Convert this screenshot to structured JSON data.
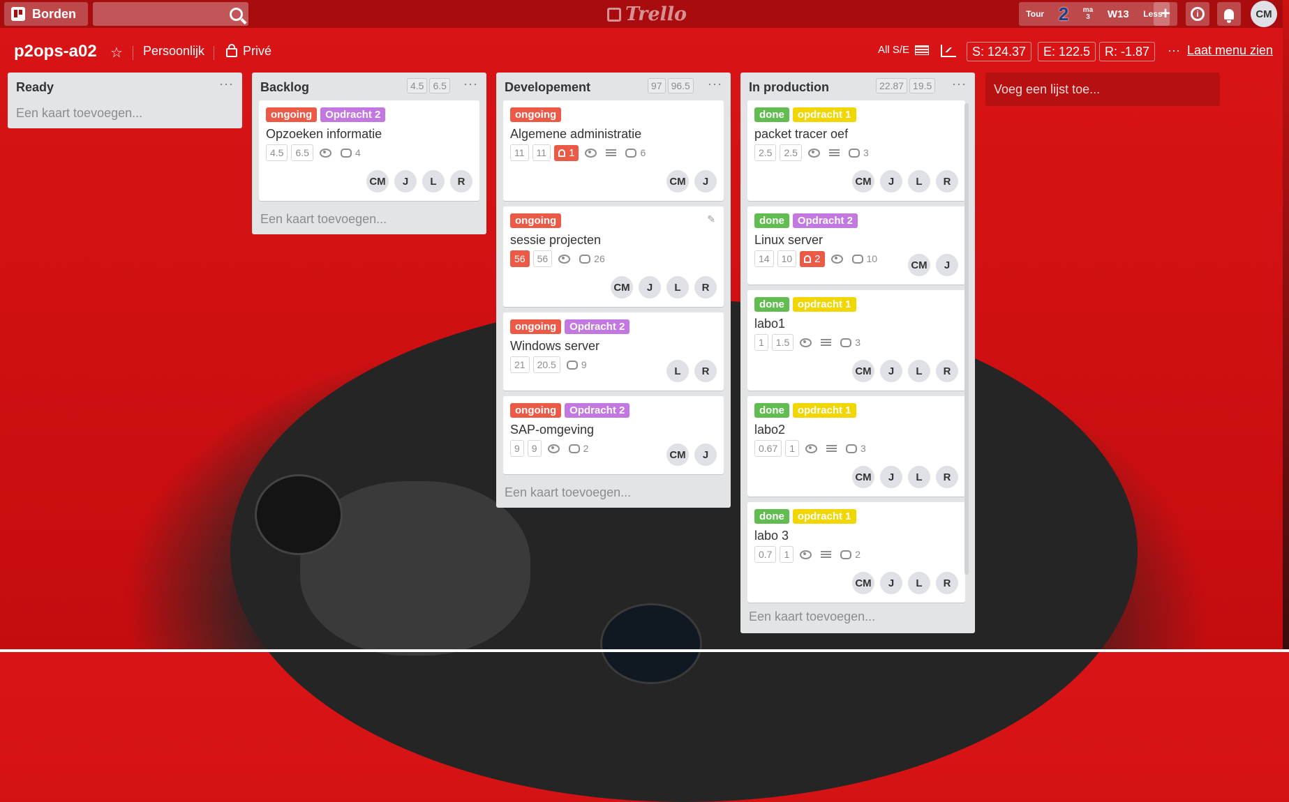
{
  "topbar": {
    "borden_label": "Borden",
    "search_placeholder": "",
    "logo_text": "Trello",
    "tour_label": "Tour",
    "tour_number": "2",
    "day_abbr": "ma",
    "day_num": "3",
    "week": "W13",
    "less": "Less",
    "user_initials": "CM"
  },
  "board": {
    "title": "p2ops-a02",
    "team": "Persoonlijk",
    "visibility": "Privé",
    "filter": "All S/E",
    "stats": {
      "s": "S: 124.37",
      "e": "E: 122.5",
      "r": "R: -1.87"
    },
    "menu_label": "Laat menu zien",
    "add_list_label": "Voeg een lijst toe...",
    "add_card_label": "Een kaart toevoegen..."
  },
  "lists": [
    {
      "name": "Ready",
      "est": [],
      "cards": []
    },
    {
      "name": "Backlog",
      "est": [
        "4.5",
        "6.5"
      ],
      "cards": [
        {
          "title": "Opzoeken informatie",
          "labels": [
            {
              "text": "ongoing",
              "type": "ongoing"
            },
            {
              "text": "Opdracht 2",
              "type": "op2"
            }
          ],
          "nums": [
            "4.5",
            "6.5"
          ],
          "comments": "4",
          "members": [
            "CM",
            "J",
            "L",
            "R"
          ]
        }
      ]
    },
    {
      "name": "Developement",
      "est": [
        "97",
        "96.5"
      ],
      "cards": [
        {
          "title": "Algemene administratie",
          "labels": [
            {
              "text": "ongoing",
              "type": "ongoing"
            }
          ],
          "nums": [
            "11",
            "11"
          ],
          "due": "1",
          "comments": "6",
          "members": [
            "CM",
            "J"
          ]
        },
        {
          "title": "sessie projecten",
          "labels": [
            {
              "text": "ongoing",
              "type": "ongoing"
            }
          ],
          "nums": [
            "56",
            "56"
          ],
          "comments": "26",
          "members": [
            "CM",
            "J",
            "L",
            "R"
          ]
        },
        {
          "title": "Windows server",
          "labels": [
            {
              "text": "ongoing",
              "type": "ongoing"
            },
            {
              "text": "Opdracht 2",
              "type": "op2"
            }
          ],
          "nums": [
            "21",
            "20.5"
          ],
          "comments": "9",
          "members": [
            "L",
            "R"
          ]
        },
        {
          "title": "SAP-omgeving",
          "labels": [
            {
              "text": "ongoing",
              "type": "ongoing"
            },
            {
              "text": "Opdracht 2",
              "type": "op2"
            }
          ],
          "nums": [
            "9",
            "9"
          ],
          "comments": "2",
          "members": [
            "CM",
            "J"
          ]
        }
      ]
    },
    {
      "name": "In production",
      "est": [
        "22.87",
        "19.5"
      ],
      "cards": [
        {
          "title": "packet tracer oef",
          "labels": [
            {
              "text": "done",
              "type": "done"
            },
            {
              "text": "opdracht 1",
              "type": "op1"
            }
          ],
          "nums": [
            "2.5",
            "2.5"
          ],
          "comments": "3",
          "members": [
            "CM",
            "J",
            "L",
            "R"
          ]
        },
        {
          "title": "Linux server",
          "labels": [
            {
              "text": "done",
              "type": "done"
            },
            {
              "text": "Opdracht 2",
              "type": "op2"
            }
          ],
          "nums": [
            "14",
            "10"
          ],
          "due": "2",
          "comments": "10",
          "members": [
            "CM",
            "J"
          ]
        },
        {
          "title": "labo1",
          "labels": [
            {
              "text": "done",
              "type": "done"
            },
            {
              "text": "opdracht 1",
              "type": "op1"
            }
          ],
          "nums": [
            "1",
            "1.5"
          ],
          "comments": "3",
          "members": [
            "CM",
            "J",
            "L",
            "R"
          ]
        },
        {
          "title": "labo2",
          "labels": [
            {
              "text": "done",
              "type": "done"
            },
            {
              "text": "opdracht 1",
              "type": "op1"
            }
          ],
          "nums": [
            "0.67",
            "1"
          ],
          "comments": "3",
          "members": [
            "CM",
            "J",
            "L",
            "R"
          ]
        },
        {
          "title": "labo 3",
          "labels": [
            {
              "text": "done",
              "type": "done"
            },
            {
              "text": "opdracht 1",
              "type": "op1"
            }
          ],
          "nums": [
            "0.7",
            "1"
          ],
          "comments": "2",
          "members": [
            "CM",
            "J",
            "L",
            "R"
          ]
        }
      ]
    }
  ]
}
